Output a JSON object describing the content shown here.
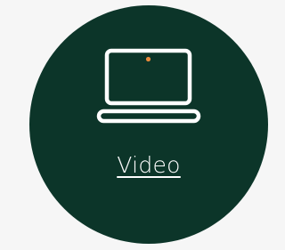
{
  "card": {
    "label": "Video",
    "icon": "laptop-icon"
  },
  "colors": {
    "background": "#f6f6f6",
    "circle": "#0c3529",
    "foreground": "#ffffff",
    "accent": "#e98a3b"
  }
}
